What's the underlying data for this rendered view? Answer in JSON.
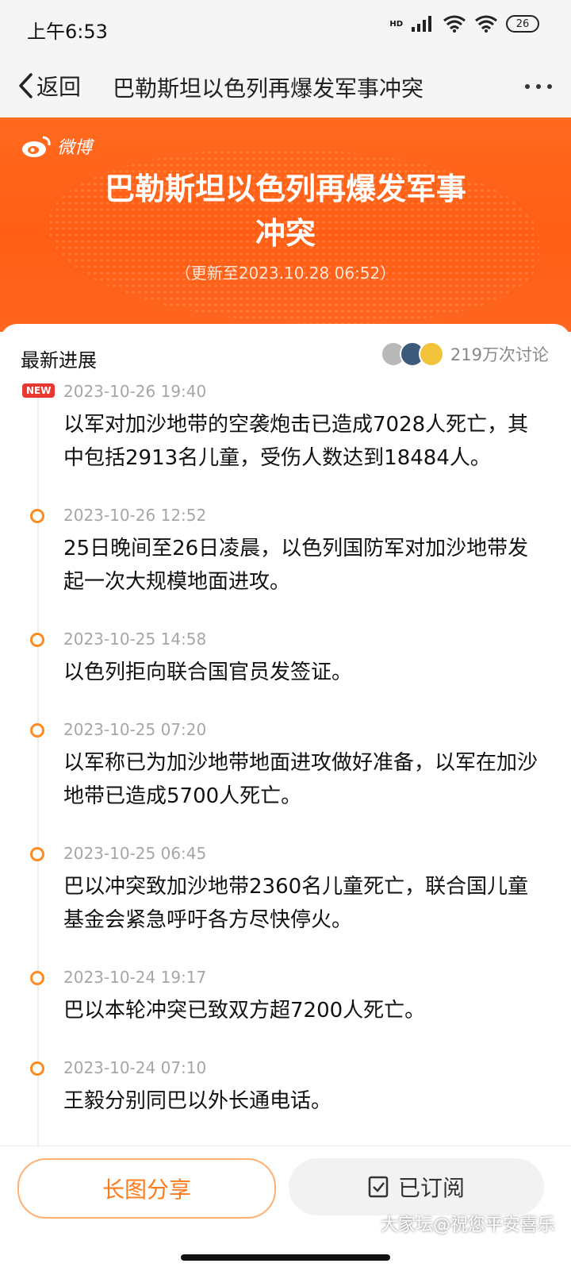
{
  "status": {
    "time": "上午6:53",
    "battery": "26",
    "network": "HD"
  },
  "nav": {
    "back_label": "返回",
    "title": "巴勒斯坦以色列再爆发军事冲突"
  },
  "banner": {
    "logo_text": "微博",
    "title_line1": "巴勒斯坦以色列再爆发军事",
    "title_line2": "冲突",
    "updated": "（更新至2023.10.28 06:52）"
  },
  "section": {
    "title": "最新进展",
    "discuss_count": "219万次讨论"
  },
  "badge_new": "NEW",
  "timeline": [
    {
      "time": "2023-10-26 19:40",
      "text": "以军对加沙地带的空袭炮击已造成7028人死亡，其中包括2913名儿童，受伤人数达到18484人。"
    },
    {
      "time": "2023-10-26 12:52",
      "text": "25日晚间至26日凌晨，以色列国防军对加沙地带发起一次大规模地面进攻。"
    },
    {
      "time": "2023-10-25 14:58",
      "text": "以色列拒向联合国官员发签证。"
    },
    {
      "time": "2023-10-25 07:20",
      "text": "以军称已为加沙地带地面进攻做好准备，以军在加沙地带已造成5700人死亡。"
    },
    {
      "time": "2023-10-25 06:45",
      "text": "巴以冲突致加沙地带2360名儿童死亡，联合国儿童基金会紧急呼吁各方尽快停火。"
    },
    {
      "time": "2023-10-24 19:17",
      "text": "巴以本轮冲突已致双方超7200人死亡。"
    },
    {
      "time": "2023-10-24 07:10",
      "text": "王毅分别同巴以外长通电话。"
    }
  ],
  "bottom": {
    "share_label": "长图分享",
    "subscribed_label": "已订阅"
  },
  "watermark": "大家坛@祝您平安喜乐",
  "colors": {
    "accent": "#ff7a1a",
    "banner": "#ff5d14",
    "new_badge": "#e8382f"
  }
}
